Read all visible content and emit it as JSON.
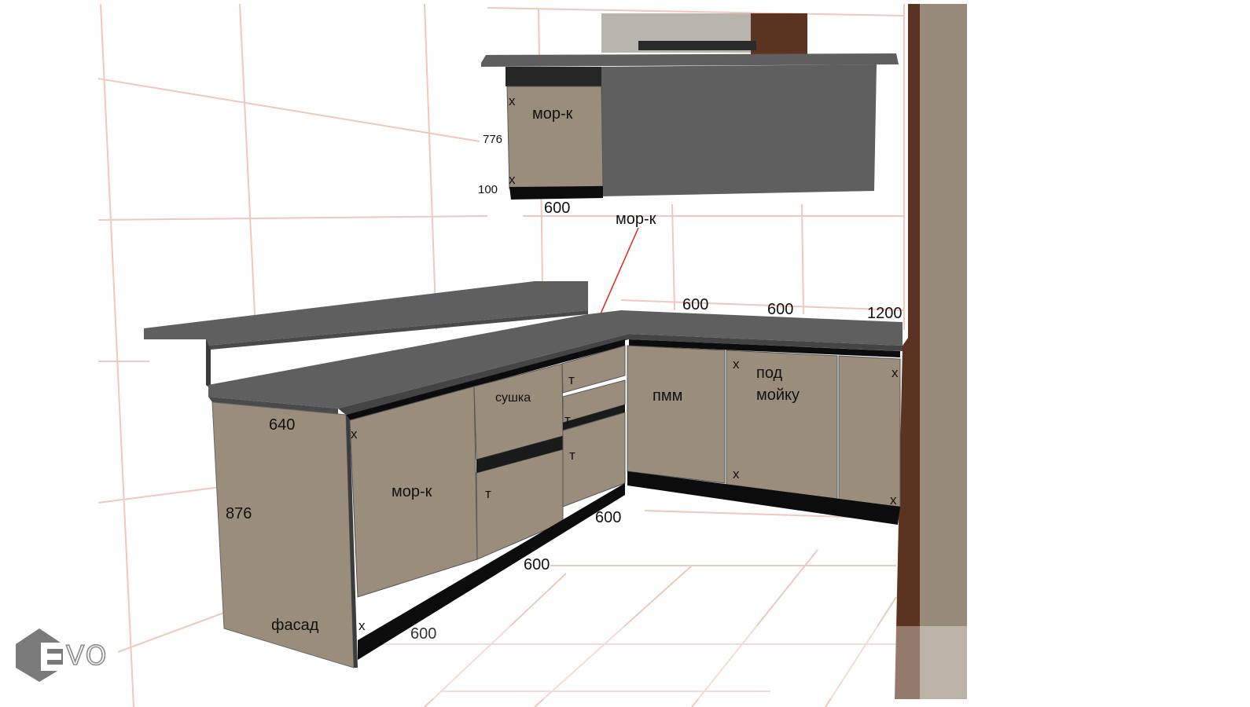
{
  "logo": {
    "text": "VO"
  },
  "inset": {
    "cabinet_label": "мор-к",
    "dim_height": "776",
    "dim_plinth": "100",
    "dim_width": "600",
    "mark_top": "x",
    "mark_bottom": "x"
  },
  "callout": {
    "label": "мор-к"
  },
  "left_run": {
    "end_panel_depth": "640",
    "end_panel_height": "876",
    "end_panel_label": "фасад",
    "fridge_label": "мор-к",
    "dryer_label": "сушка",
    "dim_600_a": "600",
    "dim_600_b": "600",
    "dim_600_c": "600",
    "mark_x_top": "x",
    "mark_x_bottom": "x",
    "mark_t1": "т",
    "mark_t2": "т",
    "mark_t3": "т",
    "mark_t4": "т"
  },
  "right_run": {
    "dishwasher_label": "пмм",
    "sink_label_line1": "под",
    "sink_label_line2": "мойку",
    "dim_600_a": "600",
    "dim_600_b": "600",
    "dim_1200": "1200",
    "mark_x1": "x",
    "mark_x2": "x",
    "mark_x3": "x",
    "mark_x4": "x"
  },
  "colors": {
    "countertop": "#5f5f5f",
    "countertop_edge": "#4a4a4a",
    "facade": "#9b8d7c",
    "plinth": "#0c0c0c",
    "wall_panel": "#978a79",
    "wood": "#5a3420",
    "grid": "#f0c8bc",
    "callout_line": "#e0251e"
  }
}
